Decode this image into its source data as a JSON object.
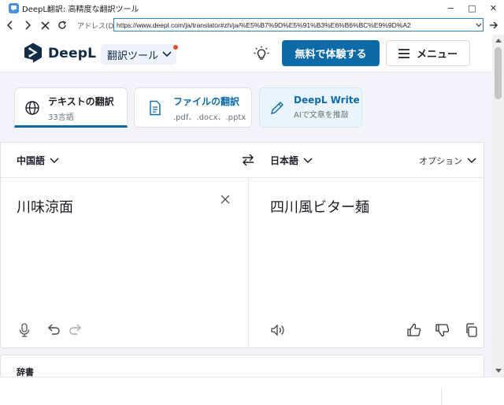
{
  "window": {
    "title": "DeepL翻訳: 高精度な翻訳ツール",
    "controls": {
      "minimize": "−",
      "maximize": "□",
      "close": "✕"
    }
  },
  "addressbar": {
    "label": "アドレス(D)",
    "url": "https://www.deepl.com/ja/translator#zh/ja/%E5%B7%9D%E5%91%B3%E6%B6%BC%E9%9D%A2"
  },
  "header": {
    "logo_text": "DeepL",
    "tools_label": "翻訳ツール",
    "free_button": "無料で体験する",
    "menu_button": "メニュー"
  },
  "tabs": [
    {
      "title": "テキストの翻訳",
      "subtitle": "33言語"
    },
    {
      "title": "ファイルの翻訳",
      "subtitle": ".pdf、.docx、.pptx"
    },
    {
      "title": "DeepL Write",
      "subtitle": "AIで文章を推敲"
    }
  ],
  "translator": {
    "source_lang": "中国語",
    "target_lang": "日本語",
    "options_label": "オプション",
    "source_text": "川味涼面",
    "target_text": "四川風ビター麺"
  },
  "dictionary": {
    "label": "辞書"
  },
  "colors": {
    "brand_blue": "#0f6ba8",
    "navy": "#0f2b46",
    "notification_dot": "#e0512b",
    "page_bg": "#f2f4f8"
  },
  "icons": {
    "tab_text": "globe-icon",
    "tab_file": "document-icon",
    "tab_write": "pencil-icon",
    "swap": "swap-arrows-icon",
    "clear": "close-icon",
    "mic": "microphone-icon",
    "undo": "undo-icon",
    "redo": "redo-icon",
    "speaker": "speaker-icon",
    "thumbs_up": "thumbs-up-icon",
    "thumbs_down": "thumbs-down-icon",
    "copy": "copy-icon"
  }
}
